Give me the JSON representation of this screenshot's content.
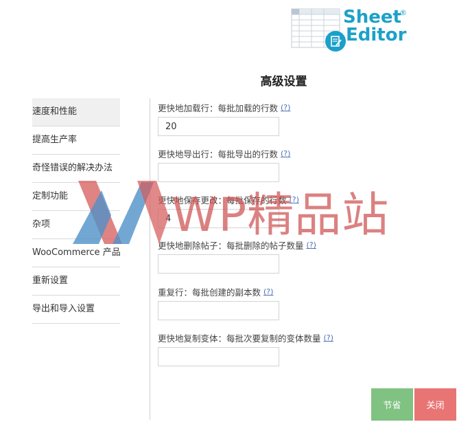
{
  "logo": {
    "line1": "Sheet",
    "line2": "Editor",
    "reg": "®"
  },
  "page_title": "高级设置",
  "sidebar": {
    "items": [
      {
        "label": "速度和性能",
        "active": true
      },
      {
        "label": "提高生产率"
      },
      {
        "label": "奇怪错误的解决办法"
      },
      {
        "label": "定制功能"
      },
      {
        "label": "杂项"
      },
      {
        "label": "WooCommerce 产品"
      },
      {
        "label": "重新设置"
      },
      {
        "label": "导出和导入设置"
      }
    ]
  },
  "fields": [
    {
      "label": "更快地加载行：每批加载的行数",
      "help": "(?)",
      "value": "20"
    },
    {
      "label": "更快地导出行：每批导出的行数",
      "help": "(?)",
      "value": ""
    },
    {
      "label": "更快地保存更改：每批保存的行数",
      "help": "(?)",
      "value": "4"
    },
    {
      "label": "更快地删除帖子：每批删除的帖子数量",
      "help": "(?)",
      "value": ""
    },
    {
      "label": "重复行：每批创建的副本数",
      "help": "(?)",
      "value": ""
    },
    {
      "label": "更快地复制变体：每批次要复制的变体数量",
      "help": "(?)",
      "value": ""
    }
  ],
  "buttons": {
    "save": "节省",
    "close": "关闭"
  },
  "watermark": "WP精品站"
}
